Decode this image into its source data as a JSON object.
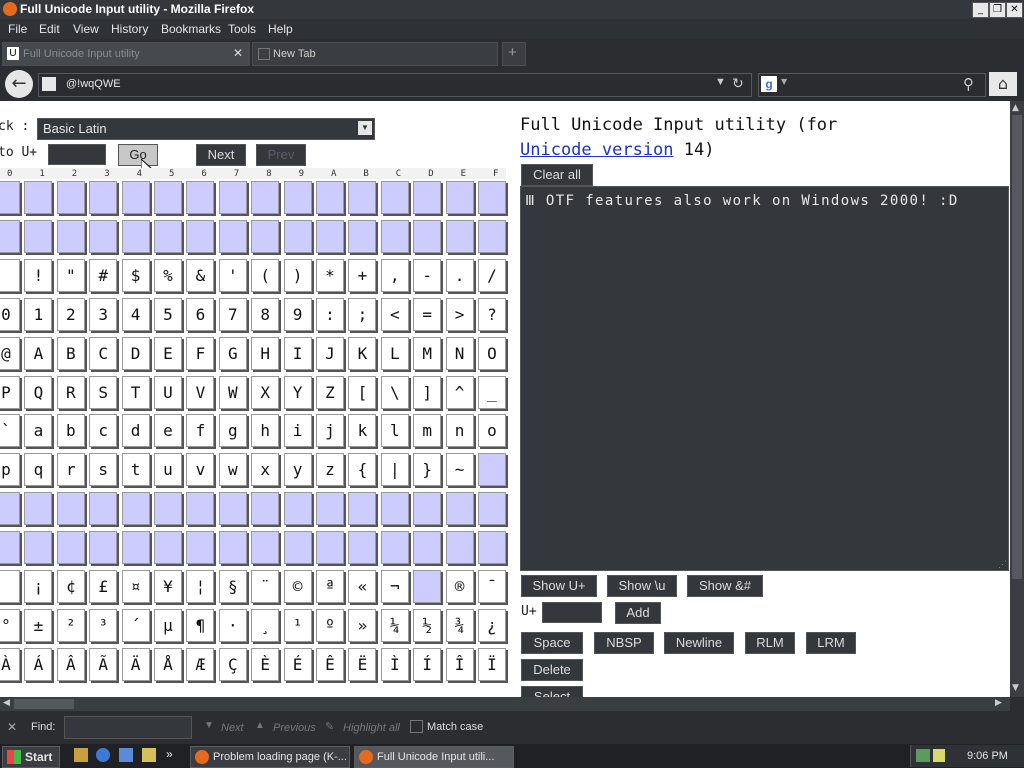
{
  "window": {
    "title": "Full Unicode Input utility - Mozilla Firefox",
    "controls": [
      "_",
      "❐",
      "✕"
    ]
  },
  "menu": [
    "File",
    "Edit",
    "View",
    "History",
    "Bookmarks",
    "Tools",
    "Help"
  ],
  "tabs": [
    {
      "label": "Full Unicode Input utility",
      "active": true
    },
    {
      "label": "New Tab",
      "active": false
    }
  ],
  "nav": {
    "url": "@!wqQWE",
    "search_placeholder": ""
  },
  "left": {
    "block_label": "ck :",
    "block_value": "Basic Latin",
    "goto_label": "to U+",
    "goto_value": "",
    "go_label": "Go",
    "next_label": "Next",
    "prev_label": "Prev",
    "headers": [
      "0",
      "1",
      "2",
      "3",
      "4",
      "5",
      "6",
      "7",
      "8",
      "9",
      "A",
      "B",
      "C",
      "D",
      "E",
      "F"
    ],
    "rows": [
      [
        "",
        "",
        "",
        "",
        "",
        "",
        "",
        "",
        "",
        "",
        "",
        "",
        "",
        "",
        "",
        ""
      ],
      [
        "",
        "",
        "",
        "",
        "",
        "",
        "",
        "",
        "",
        "",
        "",
        "",
        "",
        "",
        "",
        ""
      ],
      [
        " ",
        "!",
        "\"",
        "#",
        "$",
        "%",
        "&",
        "'",
        "(",
        ")",
        "*",
        "+",
        ",",
        "-",
        ".",
        "/"
      ],
      [
        "0",
        "1",
        "2",
        "3",
        "4",
        "5",
        "6",
        "7",
        "8",
        "9",
        ":",
        ";",
        "<",
        "=",
        ">",
        "?"
      ],
      [
        "@",
        "A",
        "B",
        "C",
        "D",
        "E",
        "F",
        "G",
        "H",
        "I",
        "J",
        "K",
        "L",
        "M",
        "N",
        "O"
      ],
      [
        "P",
        "Q",
        "R",
        "S",
        "T",
        "U",
        "V",
        "W",
        "X",
        "Y",
        "Z",
        "[",
        "\\",
        "]",
        "^",
        "_"
      ],
      [
        "`",
        "a",
        "b",
        "c",
        "d",
        "e",
        "f",
        "g",
        "h",
        "i",
        "j",
        "k",
        "l",
        "m",
        "n",
        "o"
      ],
      [
        "p",
        "q",
        "r",
        "s",
        "t",
        "u",
        "v",
        "w",
        "x",
        "y",
        "z",
        "{",
        "|",
        "}",
        "~",
        ""
      ],
      [
        "",
        "",
        "",
        "",
        "",
        "",
        "",
        "",
        "",
        "",
        "",
        "",
        "",
        "",
        "",
        ""
      ],
      [
        "",
        "",
        "",
        "",
        "",
        "",
        "",
        "",
        "",
        "",
        "",
        "",
        "",
        "",
        "",
        ""
      ],
      [
        " ",
        "¡",
        "¢",
        "£",
        "¤",
        "¥",
        "¦",
        "§",
        "¨",
        "©",
        "ª",
        "«",
        "¬",
        "",
        "®",
        "¯"
      ],
      [
        "°",
        "±",
        "²",
        "³",
        "´",
        "µ",
        "¶",
        "·",
        "¸",
        "¹",
        "º",
        "»",
        "¼",
        "½",
        "¾",
        "¿"
      ],
      [
        "À",
        "Á",
        "Â",
        "Ã",
        "Ä",
        "Å",
        "Æ",
        "Ç",
        "È",
        "É",
        "Ê",
        "Ë",
        "Ì",
        "Í",
        "Î",
        "Ï"
      ]
    ]
  },
  "right": {
    "title_line1": "Full Unicode Input utility (for",
    "title_link": "Unicode version",
    "title_rest": " 14)",
    "clear_label": "Clear all",
    "text_content": "Ⅲ OTF features also work on Windows 2000! :D",
    "buttons_row1": [
      "Show U+",
      "Show \\u",
      "Show &#"
    ],
    "uplus_label": "U+",
    "add_label": "Add",
    "buttons_row2": [
      "Space",
      "NBSP",
      "Newline",
      "RLM",
      "LRM"
    ],
    "delete_label": "Delete",
    "select_label": "Select"
  },
  "findbar": {
    "close": "✕",
    "find_label": "Find:",
    "next_label": "Next",
    "previous_label": "Previous",
    "highlight_label": "Highlight all",
    "matchcase_label": "Match case"
  },
  "taskbar": {
    "start_label": "Start",
    "tasks": [
      "Problem loading page (K-...",
      "Full Unicode Input utili..."
    ],
    "clock": "9:06 PM"
  }
}
